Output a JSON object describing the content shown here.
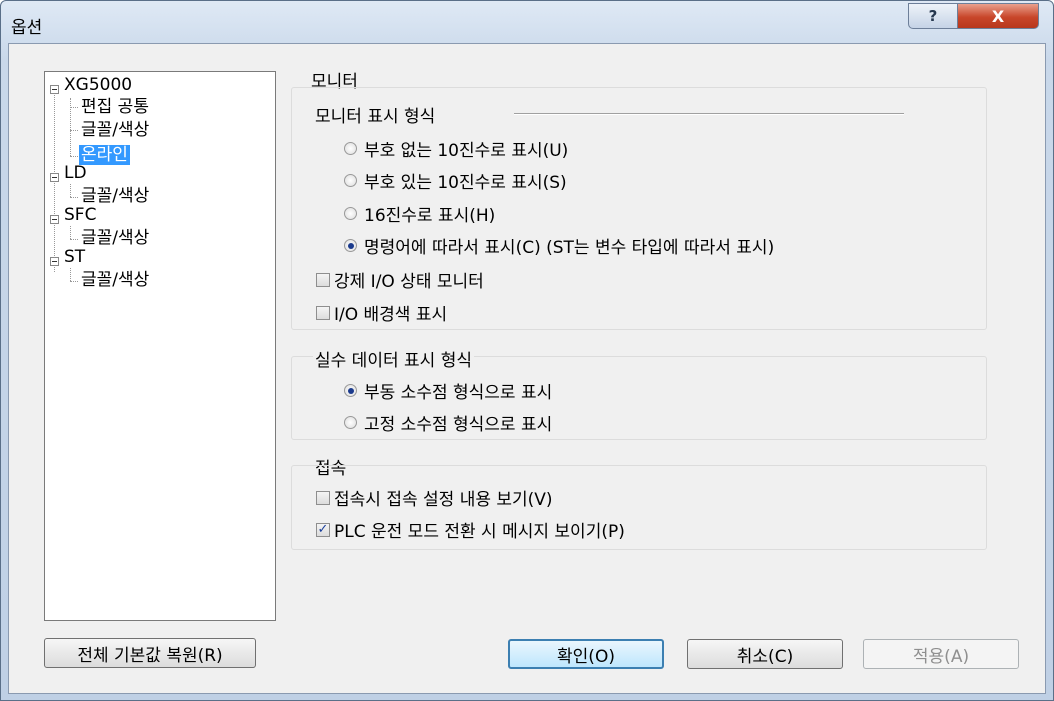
{
  "window": {
    "title": "옵션",
    "help_glyph": "?",
    "close_glyph": "X"
  },
  "tree": {
    "items": [
      {
        "label": "XG5000"
      },
      {
        "label": "편집 공통"
      },
      {
        "label": "글꼴/색상"
      },
      {
        "label": "온라인",
        "selected": true
      },
      {
        "label": "LD"
      },
      {
        "label": "글꼴/색상"
      },
      {
        "label": "SFC"
      },
      {
        "label": "글꼴/색상"
      },
      {
        "label": "ST"
      },
      {
        "label": "글꼴/색상"
      }
    ]
  },
  "monitor": {
    "section_title": "모니터",
    "display_format_title": "모니터 표시 형식",
    "options": [
      {
        "label": "부호 없는 10진수로 표시(U)",
        "checked": false
      },
      {
        "label": "부호 있는 10진수로 표시(S)",
        "checked": false
      },
      {
        "label": "16진수로 표시(H)",
        "checked": false
      },
      {
        "label": "명령어에 따라서 표시(C) (ST는 변수 타입에 따라서 표시)",
        "checked": true
      }
    ],
    "force_io_label": "강제 I/O 상태 모니터",
    "force_io_checked": false,
    "io_bg_label": "I/O 배경색 표시",
    "io_bg_checked": false
  },
  "real": {
    "title": "실수 데이터 표시 형식",
    "options": [
      {
        "label": "부동 소수점 형식으로 표시",
        "checked": true
      },
      {
        "label": "고정 소수점 형식으로 표시",
        "checked": false
      }
    ]
  },
  "connection": {
    "title": "접속",
    "show_settings_label": "접속시 접속 설정 내용 보기(V)",
    "show_settings_checked": false,
    "mode_msg_label": "PLC 운전 모드 전환 시 메시지 보이기(P)",
    "mode_msg_checked": true
  },
  "buttons": {
    "restore": "전체 기본값 복원(R)",
    "ok": "확인(O)",
    "cancel": "취소(C)",
    "apply": "적용(A)"
  },
  "colors": {
    "selection": "#3399ff",
    "close_button": "#c8462a",
    "default_button_border": "#3c7fb1"
  }
}
